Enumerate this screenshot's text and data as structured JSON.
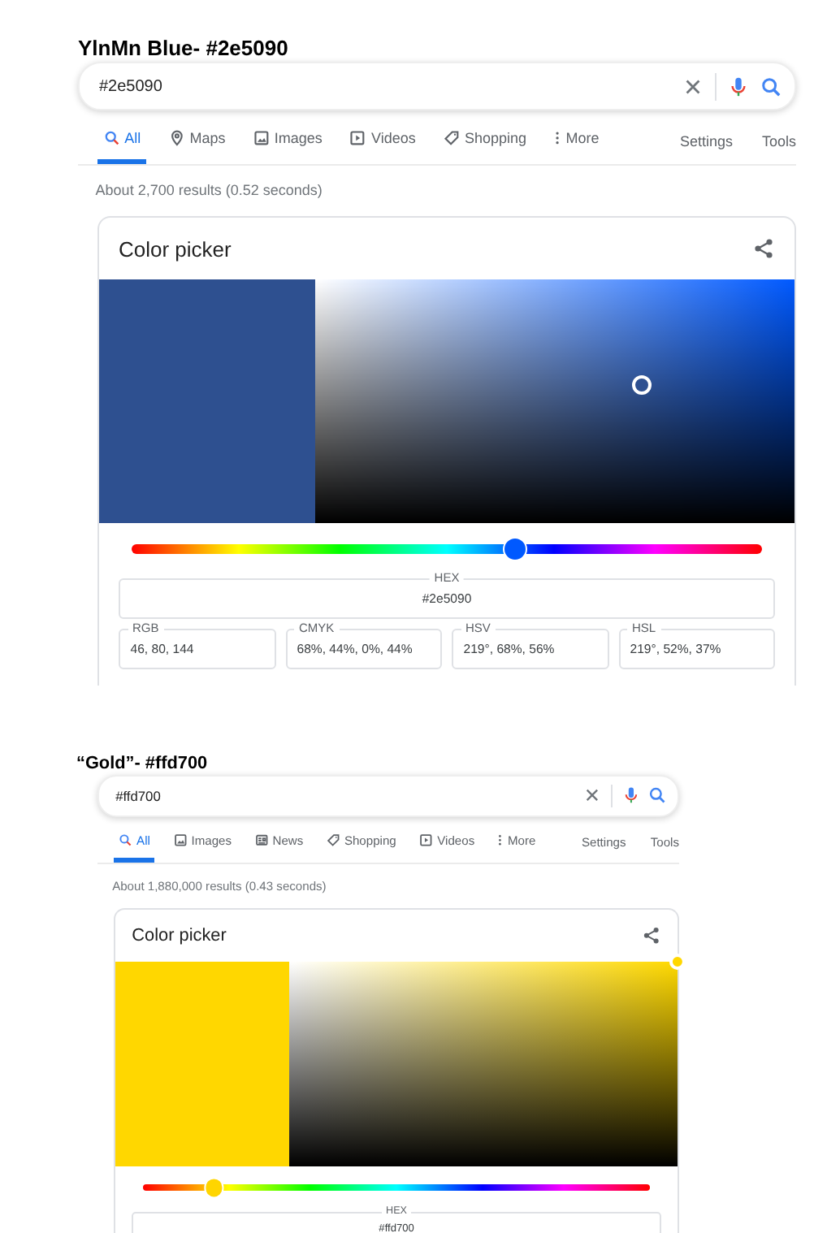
{
  "panels": [
    {
      "heading": "YlnMn Blue- #2e5090",
      "query": "#2e5090",
      "tabs": [
        {
          "label": "All",
          "kind": "search",
          "selected": true
        },
        {
          "label": "Maps",
          "kind": "pin",
          "selected": false
        },
        {
          "label": "Images",
          "kind": "image",
          "selected": false
        },
        {
          "label": "Videos",
          "kind": "video",
          "selected": false
        },
        {
          "label": "Shopping",
          "kind": "tag",
          "selected": false
        },
        {
          "label": "More",
          "kind": "more",
          "selected": false
        }
      ],
      "links": [
        "Settings",
        "Tools"
      ],
      "result_stats": "About 2,700 results (0.52 seconds)",
      "picker": {
        "title": "Color picker",
        "color": "#2e5090",
        "hue": {
          "level": 0.608
        },
        "hex": {
          "label": "HEX",
          "value": "#2e5090"
        },
        "fields": [
          {
            "label": "RGB",
            "value": "46, 80, 144"
          },
          {
            "label": "CMYK",
            "value": "68%, 44%, 0%, 44%"
          },
          {
            "label": "HSV",
            "value": "219°, 68%, 56%"
          },
          {
            "label": "HSL",
            "value": "219°, 52%, 37%"
          }
        ]
      }
    },
    {
      "heading": "“Gold”- #ffd700",
      "query": "#ffd700",
      "tabs": [
        {
          "label": "All",
          "kind": "search",
          "selected": true
        },
        {
          "label": "Images",
          "kind": "image",
          "selected": false
        },
        {
          "label": "News",
          "kind": "news",
          "selected": false
        },
        {
          "label": "Shopping",
          "kind": "tag",
          "selected": false
        },
        {
          "label": "Videos",
          "kind": "video",
          "selected": false
        },
        {
          "label": "More",
          "kind": "more",
          "selected": false
        }
      ],
      "links": [
        "Settings",
        "Tools"
      ],
      "result_stats": "About 1,880,000 results (0.43 seconds)",
      "picker": {
        "title": "Color picker",
        "color": "#ffd700",
        "hue": {
          "level": 0.14
        },
        "hex": {
          "label": "HEX",
          "value": "#ffd700"
        }
      }
    }
  ]
}
